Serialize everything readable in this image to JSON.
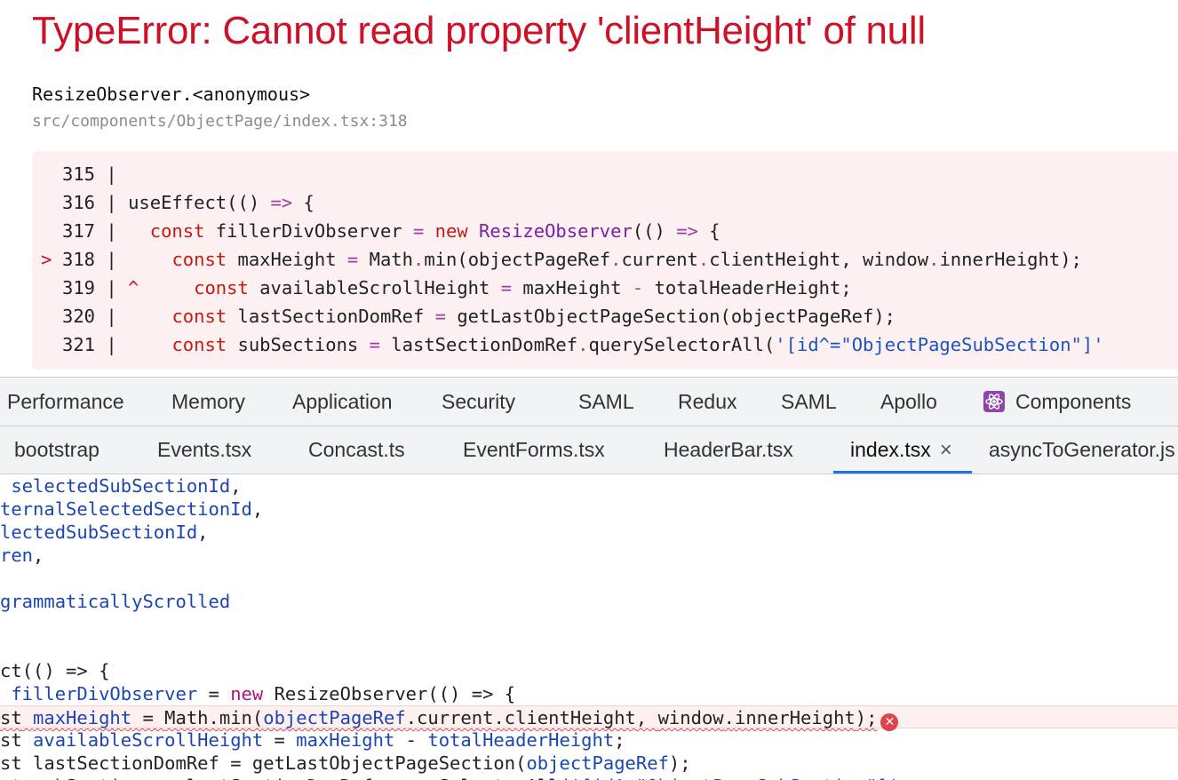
{
  "error": {
    "title": "TypeError: Cannot read property 'clientHeight' of null",
    "frame_function": "ResizeObserver.<anonymous>",
    "frame_location": "src/components/ObjectPage/index.tsx:318",
    "code_frame": [
      {
        "marker": "",
        "num": "315",
        "sep": " |",
        "caret": "",
        "code": ""
      },
      {
        "marker": "",
        "num": "316",
        "sep": " |",
        "caret": "",
        "code": "useEffect(() => {"
      },
      {
        "marker": "",
        "num": "317",
        "sep": " |",
        "caret": "",
        "code": "  const fillerDivObserver = new ResizeObserver(() => {"
      },
      {
        "marker": ">",
        "num": "318",
        "sep": " |",
        "caret": "",
        "code": "    const maxHeight = Math.min(objectPageRef.current.clientHeight, window.innerHeight);"
      },
      {
        "marker": "",
        "num": "319",
        "sep": " |",
        "caret": " ^",
        "code": "    const availableScrollHeight = maxHeight - totalHeaderHeight;"
      },
      {
        "marker": "",
        "num": "320",
        "sep": " |",
        "caret": "",
        "code": "    const lastSectionDomRef = getLastObjectPageSection(objectPageRef);"
      },
      {
        "marker": "",
        "num": "321",
        "sep": " |",
        "caret": "",
        "code": "    const subSections = lastSectionDomRef.querySelectorAll('[id^=\"ObjectPageSubSection\"]'"
      }
    ]
  },
  "devtools": {
    "tabs": [
      "Performance",
      "Memory",
      "Application",
      "Security",
      "SAML",
      "Redux",
      "SAML",
      "Apollo",
      "Components"
    ],
    "components_icon": "react-atom-icon"
  },
  "file_tabs": {
    "tabs": [
      "bootstrap",
      "Events.tsx",
      "Concast.ts",
      "EventForms.tsx",
      "HeaderBar.tsx",
      "index.tsx",
      "asyncToGenerator.js"
    ],
    "active": "index.tsx"
  },
  "editor": {
    "lines": [
      " selectedSubSectionId,",
      "ternalSelectedSectionId,",
      "lectedSubSectionId,",
      "ren,",
      "",
      "grammaticallyScrolled",
      "",
      "",
      "ct(() => {",
      " fillerDivObserver = new ResizeObserver(() => {",
      "st maxHeight = Math.min(objectPageRef.current.clientHeight, window.innerHeight);",
      "st availableScrollHeight = maxHeight - totalHeaderHeight;",
      "st lastSectionDomRef = getLastObjectPageSection(objectPageRef);",
      "st subSections = lastSectionDomRef.querySelectorAll('[id^=\"ObjectPageSubSection\"]'"
    ],
    "error_line_index": 10
  },
  "colors": {
    "error_red": "#ce1126",
    "active_tab_blue": "#1a73e8",
    "code_frame_bg": "#fcf0f0"
  }
}
